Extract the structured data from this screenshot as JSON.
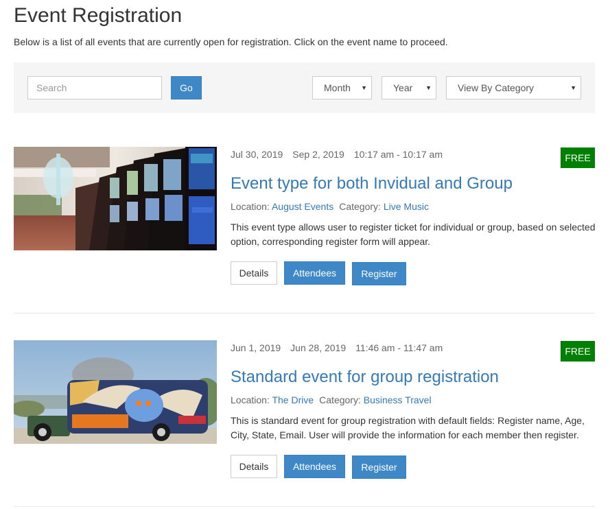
{
  "page": {
    "title": "Event Registration",
    "intro": "Below is a list of all events that are currently open for registration. Click on the event name to proceed."
  },
  "filters": {
    "search_placeholder": "Search",
    "search_value": "",
    "go_label": "Go",
    "month": {
      "selected": "Month"
    },
    "year": {
      "selected": "Year"
    },
    "category": {
      "selected": "View By Category"
    },
    "caret_icon": "triangle-down"
  },
  "events": [
    {
      "start_date": "Jul 30, 2019",
      "end_date": "Sep 2, 2019",
      "time": "10:17 am - 10:17 am",
      "price_badge": "FREE",
      "title": "Event type for both Invidual and Group",
      "location_label": "Location:",
      "location": "August Events",
      "category_label": "Category:",
      "category": "Live Music",
      "description": "This event type allows user to register ticket for individual or group, based on selected option, corresponding register form will appear.",
      "image": "casino-slot-machines",
      "buttons": {
        "details": "Details",
        "attendees": "Attendees",
        "register": "Register"
      }
    },
    {
      "start_date": "Jun 1, 2019",
      "end_date": "Jun 28, 2019",
      "time": "11:46 am - 11:47 am",
      "price_badge": "FREE",
      "title": "Standard event for group registration",
      "location_label": "Location:",
      "location": "The Drive",
      "category_label": "Category:",
      "category": "Business Travel",
      "description": "This is standard event for group registration with default fields: Register name, Age, City, State, Email. User will provide the information for each member then register.",
      "image": "graffiti-bus-freedom",
      "buttons": {
        "details": "Details",
        "attendees": "Attendees",
        "register": "Register"
      }
    }
  ],
  "colors": {
    "primary": "#3f88c8",
    "link": "#337ab7",
    "badge_free": "#008000",
    "filter_bg": "#f5f5f5"
  }
}
